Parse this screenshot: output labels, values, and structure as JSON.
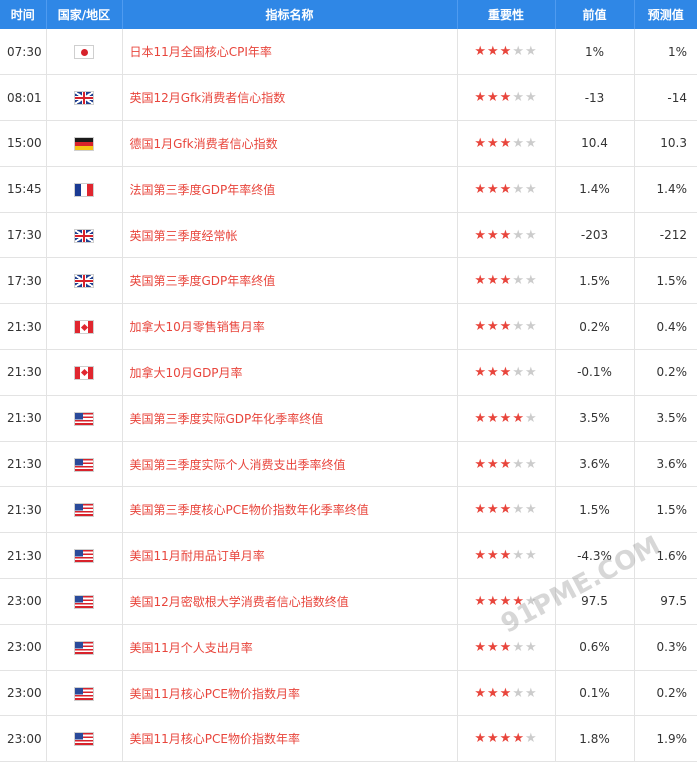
{
  "header": {
    "time": "时间",
    "country": "国家/地区",
    "name": "指标名称",
    "importance": "重要性",
    "previous": "前值",
    "forecast": "预测值"
  },
  "rows": [
    {
      "time": "07:30",
      "flag": "jp",
      "name": "日本11月全国核心CPI年率",
      "stars": 3,
      "prev": "1%",
      "fore": "1%"
    },
    {
      "time": "08:01",
      "flag": "gb",
      "name": "英国12月Gfk消费者信心指数",
      "stars": 3,
      "prev": "-13",
      "fore": "-14"
    },
    {
      "time": "15:00",
      "flag": "de",
      "name": "德国1月Gfk消费者信心指数",
      "stars": 3,
      "prev": "10.4",
      "fore": "10.3"
    },
    {
      "time": "15:45",
      "flag": "fr",
      "name": "法国第三季度GDP年率终值",
      "stars": 3,
      "prev": "1.4%",
      "fore": "1.4%"
    },
    {
      "time": "17:30",
      "flag": "gb",
      "name": "英国第三季度经常帐",
      "stars": 3,
      "prev": "-203",
      "fore": "-212"
    },
    {
      "time": "17:30",
      "flag": "gb",
      "name": "英国第三季度GDP年率终值",
      "stars": 3,
      "prev": "1.5%",
      "fore": "1.5%"
    },
    {
      "time": "21:30",
      "flag": "ca",
      "name": "加拿大10月零售销售月率",
      "stars": 3,
      "prev": "0.2%",
      "fore": "0.4%"
    },
    {
      "time": "21:30",
      "flag": "ca",
      "name": "加拿大10月GDP月率",
      "stars": 3,
      "prev": "-0.1%",
      "fore": "0.2%"
    },
    {
      "time": "21:30",
      "flag": "us",
      "name": "美国第三季度实际GDP年化季率终值",
      "stars": 4,
      "prev": "3.5%",
      "fore": "3.5%"
    },
    {
      "time": "21:30",
      "flag": "us",
      "name": "美国第三季度实际个人消费支出季率终值",
      "stars": 3,
      "prev": "3.6%",
      "fore": "3.6%"
    },
    {
      "time": "21:30",
      "flag": "us",
      "name": "美国第三季度核心PCE物价指数年化季率终值",
      "stars": 3,
      "prev": "1.5%",
      "fore": "1.5%"
    },
    {
      "time": "21:30",
      "flag": "us",
      "name": "美国11月耐用品订单月率",
      "stars": 3,
      "prev": "-4.3%",
      "fore": "1.6%"
    },
    {
      "time": "23:00",
      "flag": "us",
      "name": "美国12月密歇根大学消费者信心指数终值",
      "stars": 4,
      "prev": "97.5",
      "fore": "97.5"
    },
    {
      "time": "23:00",
      "flag": "us",
      "name": "美国11月个人支出月率",
      "stars": 3,
      "prev": "0.6%",
      "fore": "0.3%"
    },
    {
      "time": "23:00",
      "flag": "us",
      "name": "美国11月核心PCE物价指数月率",
      "stars": 3,
      "prev": "0.1%",
      "fore": "0.2%"
    },
    {
      "time": "23:00",
      "flag": "us",
      "name": "美国11月核心PCE物价指数年率",
      "stars": 4,
      "prev": "1.8%",
      "fore": "1.9%"
    }
  ],
  "watermark": "91PME.COM",
  "colors": {
    "header_bg": "#2f87e6",
    "indicator_text": "#e8453c",
    "star_on": "#e8453c",
    "star_off": "#cccccc"
  }
}
